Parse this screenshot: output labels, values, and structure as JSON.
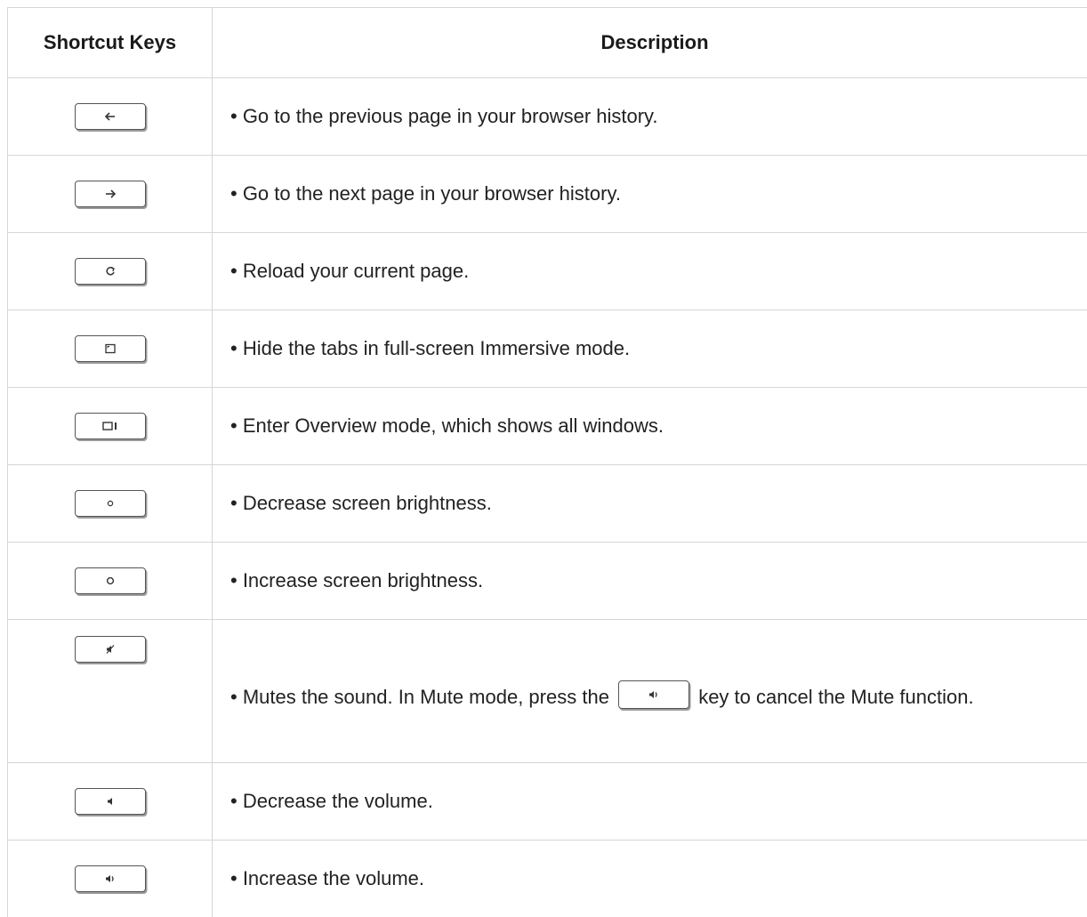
{
  "table": {
    "headers": {
      "keys": "Shortcut Keys",
      "description": "Description"
    },
    "rows": [
      {
        "icon": "back-arrow-icon",
        "description": "• Go to the previous page in your browser history."
      },
      {
        "icon": "forward-arrow-icon",
        "description": "• Go to the next page in your browser history."
      },
      {
        "icon": "reload-icon",
        "description": "• Reload your current page."
      },
      {
        "icon": "fullscreen-icon",
        "description": "• Hide the tabs in full-screen Immersive mode."
      },
      {
        "icon": "overview-icon",
        "description": "• Enter Overview mode, which shows all windows."
      },
      {
        "icon": "brightness-down-icon",
        "description": "• Decrease screen brightness."
      },
      {
        "icon": "brightness-up-icon",
        "description": "• Increase screen brightness."
      },
      {
        "icon": "mute-icon",
        "description_before": "• Mutes the sound. In Mute mode, press the",
        "inline_icon": "volume-up-icon",
        "description_after": "key to cancel the Mute function."
      },
      {
        "icon": "volume-down-icon",
        "description": "• Decrease the volume."
      },
      {
        "icon": "volume-up-icon",
        "description": "• Increase the volume."
      }
    ]
  }
}
